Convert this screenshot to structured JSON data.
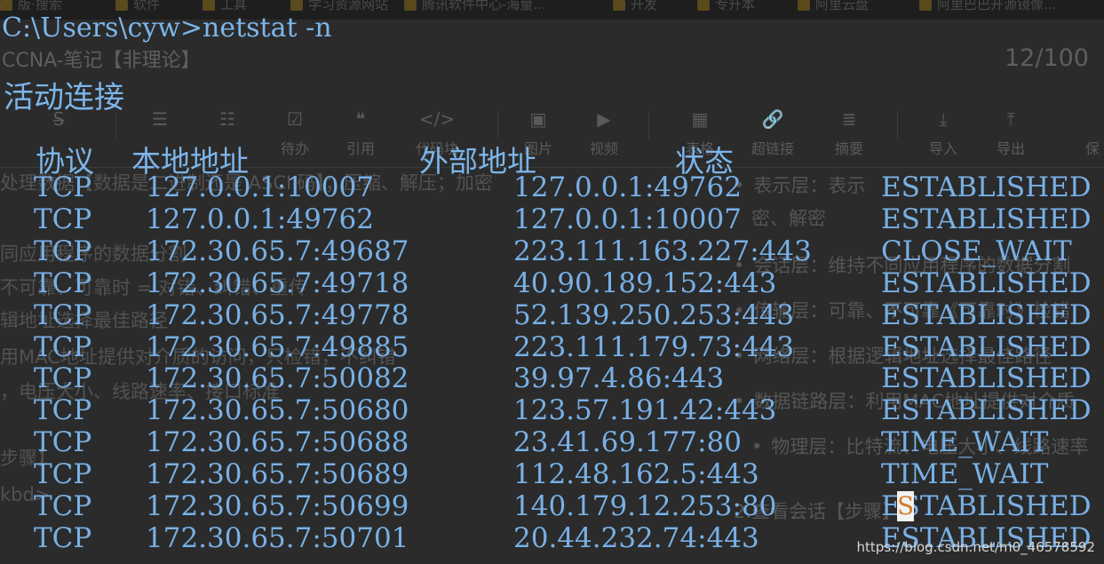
{
  "background": {
    "bookmarks": [
      "版·搜索",
      "软件",
      "工具",
      "学习资源网站",
      "腾讯软件中心-海量...",
      "开发",
      "专升本",
      "阿里云盘",
      "阿里巴巴开源镜像..."
    ],
    "doc_title": "CCNA-笔记【非理论】",
    "title_counter": "12/100",
    "toolbar": [
      {
        "icon": "strikethrough-icon",
        "glyph": "S̶",
        "label": ""
      },
      {
        "icon": "unordered-list-icon",
        "glyph": "☰",
        "label": ""
      },
      {
        "icon": "ordered-list-icon",
        "glyph": "☷",
        "label": ""
      },
      {
        "icon": "todo-list-icon",
        "glyph": "☑",
        "label": "待办"
      },
      {
        "icon": "quote-icon",
        "glyph": "❝",
        "label": "引用"
      },
      {
        "icon": "code-icon",
        "glyph": "</>",
        "label": "代码块"
      },
      {
        "icon": "image-icon",
        "glyph": "▣",
        "label": "图片"
      },
      {
        "icon": "video-icon",
        "glyph": "▶",
        "label": "视频"
      },
      {
        "icon": "table-icon",
        "glyph": "▦",
        "label": "表格"
      },
      {
        "icon": "link-icon",
        "glyph": "🔗",
        "label": "超链接"
      },
      {
        "icon": "summary-icon",
        "glyph": "≣",
        "label": "摘要"
      },
      {
        "icon": "import-icon",
        "glyph": "⤓",
        "label": "导入"
      },
      {
        "icon": "export-icon",
        "glyph": "⤒",
        "label": "导出"
      },
      {
        "icon": "save-icon",
        "glyph": "",
        "label": "保"
      }
    ],
    "left_lines": [
      "处理数据【数据是二进制还是 ASCII码】；压缩、解压；加密",
      "同应用程序的数据分割",
      "不可靠、可靠时 = 对错、纠错、重传",
      "辑地址选择最佳路径",
      "用MAC地址提供对介质的访问，只检错，不纠错",
      "，电压大小、线路速率、接口标准",
      "步骤】",
      "kbd>"
    ],
    "right_lines": [
      "表示层：表示",
      "密、解密",
      "会话层：维持不同应用程序的数据分割",
      "传输层：可靠、不可靠《可靠时》检错",
      "网络层：根据逻辑地址选择最佳路径",
      "数据链路层：利用MAC地址提供对介质",
      "物理层：比特流、电压大小、线路速率",
      "2.查看会话【步骤】"
    ]
  },
  "terminal": {
    "command_line": "C:\\Users\\cyw>netstat -n",
    "section_title": "活动连接",
    "columns": [
      "协议",
      "本地地址",
      "外部地址",
      "状态"
    ],
    "connections": [
      {
        "proto": "TCP",
        "local": "127.0.0.1:10007",
        "foreign": "127.0.0.1:49762",
        "state": "ESTABLISHED"
      },
      {
        "proto": "TCP",
        "local": "127.0.0.1:49762",
        "foreign": "127.0.0.1:10007",
        "state": "ESTABLISHED"
      },
      {
        "proto": "TCP",
        "local": "172.30.65.7:49687",
        "foreign": "223.111.163.227:443",
        "state": "CLOSE_WAIT"
      },
      {
        "proto": "TCP",
        "local": "172.30.65.7:49718",
        "foreign": "40.90.189.152:443",
        "state": "ESTABLISHED"
      },
      {
        "proto": "TCP",
        "local": "172.30.65.7:49778",
        "foreign": "52.139.250.253:443",
        "state": "ESTABLISHED"
      },
      {
        "proto": "TCP",
        "local": "172.30.65.7:49885",
        "foreign": "223.111.179.73:443",
        "state": "ESTABLISHED"
      },
      {
        "proto": "TCP",
        "local": "172.30.65.7:50082",
        "foreign": "39.97.4.86:443",
        "state": "ESTABLISHED"
      },
      {
        "proto": "TCP",
        "local": "172.30.65.7:50680",
        "foreign": "123.57.191.42:443",
        "state": "ESTABLISHED"
      },
      {
        "proto": "TCP",
        "local": "172.30.65.7:50688",
        "foreign": "23.41.69.177:80",
        "state": "TIME_WAIT"
      },
      {
        "proto": "TCP",
        "local": "172.30.65.7:50689",
        "foreign": "112.48.162.5:443",
        "state": "TIME_WAIT"
      },
      {
        "proto": "TCP",
        "local": "172.30.65.7:50699",
        "foreign": "140.179.12.253:80",
        "state": "ESTABLISHED"
      },
      {
        "proto": "TCP",
        "local": "172.30.65.7:50701",
        "foreign": "20.44.232.74:443",
        "state": "ESTABLISHED"
      }
    ],
    "cursor_char": "S"
  },
  "watermark": "https://blog.csdn.net/m0_46578592",
  "colors": {
    "terminal_text": "#7cb5ea",
    "background": "#2b2b2b",
    "cursor_bg": "#f2f2f2",
    "cursor_fg": "#d87a2a"
  }
}
